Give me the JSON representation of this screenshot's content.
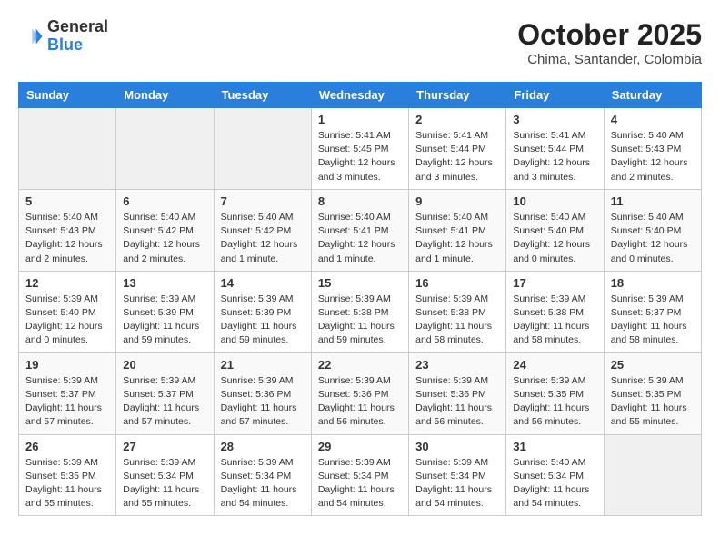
{
  "header": {
    "logo_general": "General",
    "logo_blue": "Blue",
    "month": "October 2025",
    "location": "Chima, Santander, Colombia"
  },
  "weekdays": [
    "Sunday",
    "Monday",
    "Tuesday",
    "Wednesday",
    "Thursday",
    "Friday",
    "Saturday"
  ],
  "weeks": [
    [
      {
        "day": "",
        "empty": true
      },
      {
        "day": "",
        "empty": true
      },
      {
        "day": "",
        "empty": true
      },
      {
        "day": "1",
        "sunrise": "5:41 AM",
        "sunset": "5:45 PM",
        "daylight": "12 hours and 3 minutes."
      },
      {
        "day": "2",
        "sunrise": "5:41 AM",
        "sunset": "5:44 PM",
        "daylight": "12 hours and 3 minutes."
      },
      {
        "day": "3",
        "sunrise": "5:41 AM",
        "sunset": "5:44 PM",
        "daylight": "12 hours and 3 minutes."
      },
      {
        "day": "4",
        "sunrise": "5:40 AM",
        "sunset": "5:43 PM",
        "daylight": "12 hours and 2 minutes."
      }
    ],
    [
      {
        "day": "5",
        "sunrise": "5:40 AM",
        "sunset": "5:43 PM",
        "daylight": "12 hours and 2 minutes."
      },
      {
        "day": "6",
        "sunrise": "5:40 AM",
        "sunset": "5:42 PM",
        "daylight": "12 hours and 2 minutes."
      },
      {
        "day": "7",
        "sunrise": "5:40 AM",
        "sunset": "5:42 PM",
        "daylight": "12 hours and 1 minute."
      },
      {
        "day": "8",
        "sunrise": "5:40 AM",
        "sunset": "5:41 PM",
        "daylight": "12 hours and 1 minute."
      },
      {
        "day": "9",
        "sunrise": "5:40 AM",
        "sunset": "5:41 PM",
        "daylight": "12 hours and 1 minute."
      },
      {
        "day": "10",
        "sunrise": "5:40 AM",
        "sunset": "5:40 PM",
        "daylight": "12 hours and 0 minutes."
      },
      {
        "day": "11",
        "sunrise": "5:40 AM",
        "sunset": "5:40 PM",
        "daylight": "12 hours and 0 minutes."
      }
    ],
    [
      {
        "day": "12",
        "sunrise": "5:39 AM",
        "sunset": "5:40 PM",
        "daylight": "12 hours and 0 minutes."
      },
      {
        "day": "13",
        "sunrise": "5:39 AM",
        "sunset": "5:39 PM",
        "daylight": "11 hours and 59 minutes."
      },
      {
        "day": "14",
        "sunrise": "5:39 AM",
        "sunset": "5:39 PM",
        "daylight": "11 hours and 59 minutes."
      },
      {
        "day": "15",
        "sunrise": "5:39 AM",
        "sunset": "5:38 PM",
        "daylight": "11 hours and 59 minutes."
      },
      {
        "day": "16",
        "sunrise": "5:39 AM",
        "sunset": "5:38 PM",
        "daylight": "11 hours and 58 minutes."
      },
      {
        "day": "17",
        "sunrise": "5:39 AM",
        "sunset": "5:38 PM",
        "daylight": "11 hours and 58 minutes."
      },
      {
        "day": "18",
        "sunrise": "5:39 AM",
        "sunset": "5:37 PM",
        "daylight": "11 hours and 58 minutes."
      }
    ],
    [
      {
        "day": "19",
        "sunrise": "5:39 AM",
        "sunset": "5:37 PM",
        "daylight": "11 hours and 57 minutes."
      },
      {
        "day": "20",
        "sunrise": "5:39 AM",
        "sunset": "5:37 PM",
        "daylight": "11 hours and 57 minutes."
      },
      {
        "day": "21",
        "sunrise": "5:39 AM",
        "sunset": "5:36 PM",
        "daylight": "11 hours and 57 minutes."
      },
      {
        "day": "22",
        "sunrise": "5:39 AM",
        "sunset": "5:36 PM",
        "daylight": "11 hours and 56 minutes."
      },
      {
        "day": "23",
        "sunrise": "5:39 AM",
        "sunset": "5:36 PM",
        "daylight": "11 hours and 56 minutes."
      },
      {
        "day": "24",
        "sunrise": "5:39 AM",
        "sunset": "5:35 PM",
        "daylight": "11 hours and 56 minutes."
      },
      {
        "day": "25",
        "sunrise": "5:39 AM",
        "sunset": "5:35 PM",
        "daylight": "11 hours and 55 minutes."
      }
    ],
    [
      {
        "day": "26",
        "sunrise": "5:39 AM",
        "sunset": "5:35 PM",
        "daylight": "11 hours and 55 minutes."
      },
      {
        "day": "27",
        "sunrise": "5:39 AM",
        "sunset": "5:34 PM",
        "daylight": "11 hours and 55 minutes."
      },
      {
        "day": "28",
        "sunrise": "5:39 AM",
        "sunset": "5:34 PM",
        "daylight": "11 hours and 54 minutes."
      },
      {
        "day": "29",
        "sunrise": "5:39 AM",
        "sunset": "5:34 PM",
        "daylight": "11 hours and 54 minutes."
      },
      {
        "day": "30",
        "sunrise": "5:39 AM",
        "sunset": "5:34 PM",
        "daylight": "11 hours and 54 minutes."
      },
      {
        "day": "31",
        "sunrise": "5:40 AM",
        "sunset": "5:34 PM",
        "daylight": "11 hours and 54 minutes."
      },
      {
        "day": "",
        "empty": true
      }
    ]
  ]
}
